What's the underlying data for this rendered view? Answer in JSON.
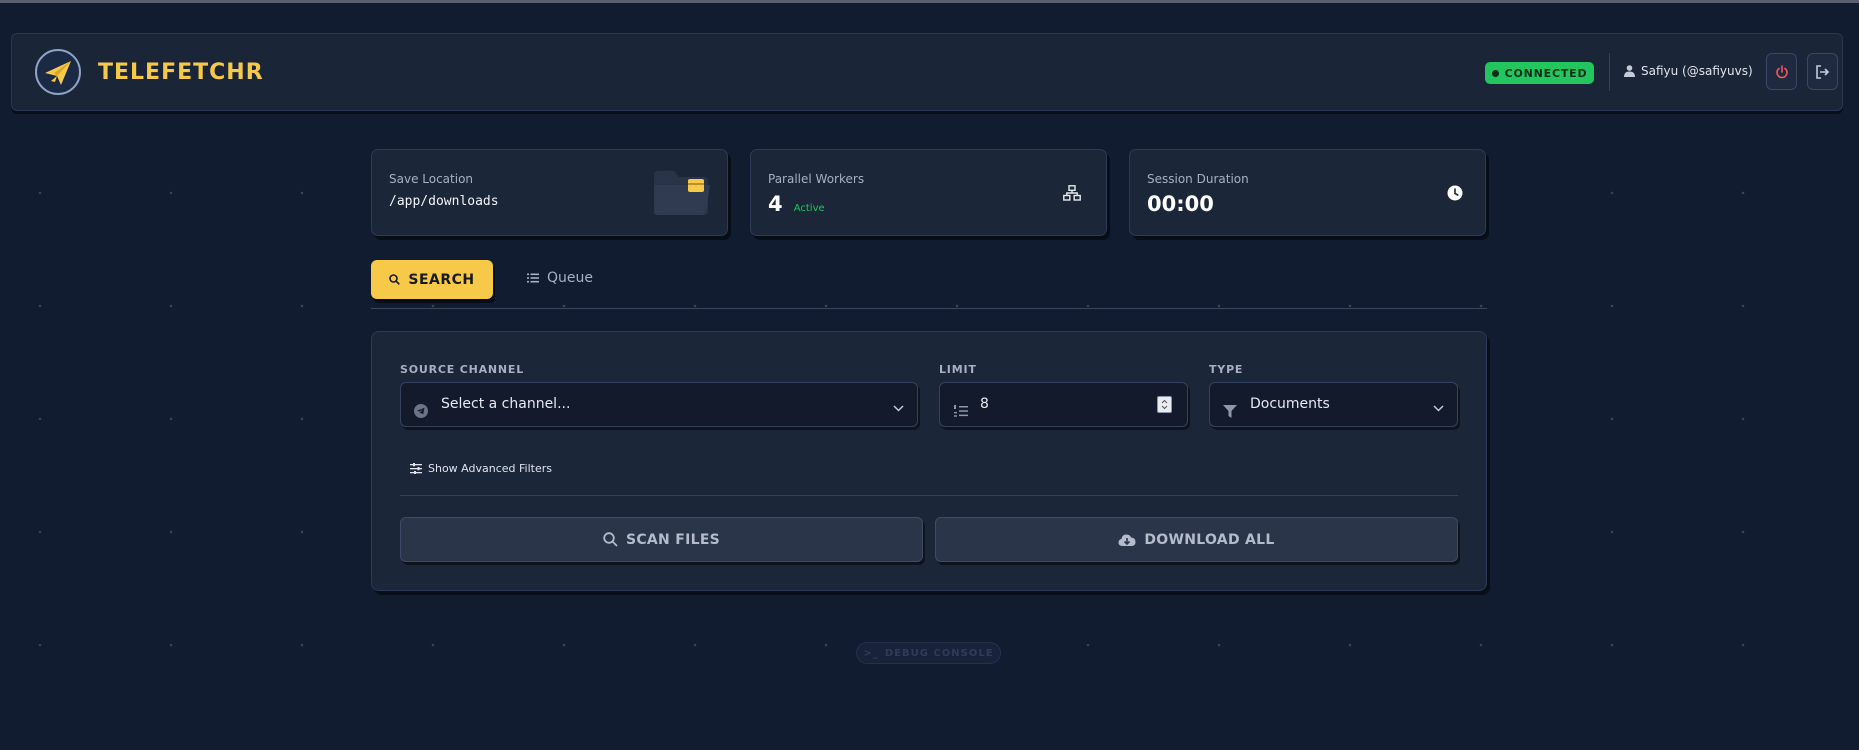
{
  "app": {
    "title": "TELEFETCHR"
  },
  "header": {
    "status": "CONNECTED",
    "user": "Safiyu (@safiyuvs)"
  },
  "stats": {
    "save_location": {
      "label": "Save Location",
      "value": "/app/downloads"
    },
    "parallel_workers": {
      "label": "Parallel Workers",
      "value": "4",
      "status": "Active"
    },
    "session_duration": {
      "label": "Session Duration",
      "value": "00:00"
    }
  },
  "tabs": {
    "search": "SEARCH",
    "queue": "Queue"
  },
  "form": {
    "source_channel": {
      "label": "SOURCE CHANNEL",
      "value": "Select a channel..."
    },
    "limit": {
      "label": "LIMIT",
      "value": "8"
    },
    "type": {
      "label": "TYPE",
      "value": "Documents"
    },
    "advanced_toggle": "Show Advanced Filters"
  },
  "actions": {
    "scan": "SCAN FILES",
    "download_all": "DOWNLOAD ALL"
  },
  "debug": {
    "label": "DEBUG CONSOLE",
    "prompt": ">_"
  },
  "colors": {
    "accent": "#f7c948",
    "connected": "#22c55e",
    "background": "#111c30",
    "panel": "#1c2639"
  }
}
